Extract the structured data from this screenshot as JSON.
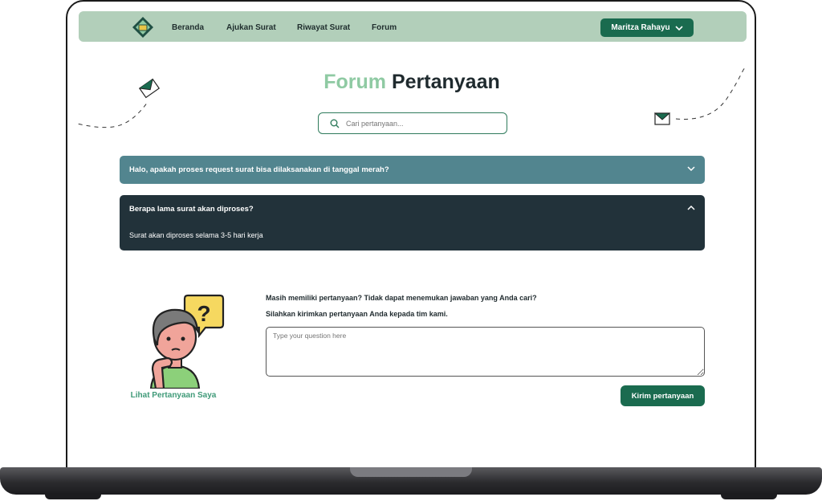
{
  "nav": {
    "links": [
      "Beranda",
      "Ajukan Surat",
      "Riwayat Surat",
      "Forum"
    ],
    "user_name": "Maritza Rahayu"
  },
  "page": {
    "title_part1": "Forum",
    "title_part2": "Pertanyaan"
  },
  "search": {
    "placeholder": "Cari pertanyaan..."
  },
  "faq": [
    {
      "question": "Halo, apakah proses request surat bisa dilaksanakan di tanggal merah?",
      "expanded": false,
      "color": "#52858f"
    },
    {
      "question": "Berapa lama surat akan diproses?",
      "answer": "Surat akan diproses selama 3-5 hari kerja",
      "expanded": true,
      "color": "#22323a"
    }
  ],
  "ask": {
    "prompt1": "Masih memiliki pertanyaan? Tidak dapat menemukan jawaban yang Anda cari?",
    "prompt2": "Silahkan kirimkan pertanyaan Anda kepada tim kami.",
    "textarea_placeholder": "Type your question here",
    "submit_label": "Kirim pertanyaan",
    "my_questions_link": "Lihat Pertanyaan Saya"
  },
  "colors": {
    "primary": "#1a6b4f",
    "navbar": "#b2cfba",
    "accent": "#8fcaa3"
  }
}
